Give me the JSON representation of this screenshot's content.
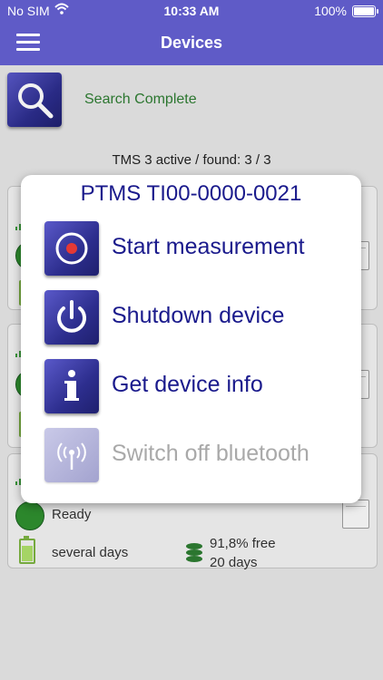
{
  "status_bar": {
    "carrier": "No SIM",
    "time": "10:33 AM",
    "battery_percent": "100%",
    "battery_level": 1.0
  },
  "nav": {
    "title": "Devices"
  },
  "search": {
    "status": "Search Complete",
    "summary": "TMS 3 active / found: 3 / 3"
  },
  "cards": [
    {
      "status": "",
      "battery": "",
      "storage_free": "",
      "storage_days": ""
    },
    {
      "status": "",
      "battery": "",
      "storage_free": "",
      "storage_days": ""
    },
    {
      "status": "Ready",
      "battery": "several days",
      "storage_free": "91,8% free",
      "storage_days": "20 days"
    }
  ],
  "modal": {
    "title": "PTMS TI00-0000-0021",
    "actions": [
      {
        "icon": "record-icon",
        "label": "Start measurement",
        "enabled": true
      },
      {
        "icon": "power-icon",
        "label": "Shutdown device",
        "enabled": true
      },
      {
        "icon": "info-icon",
        "label": "Get device info",
        "enabled": true
      },
      {
        "icon": "bluetooth-antenna-icon",
        "label": "Switch off bluetooth",
        "enabled": false
      }
    ]
  },
  "colors": {
    "header": "#5f5bc7",
    "button_dark": "#2d2e8e",
    "modal_text": "#1a1a8c",
    "status_green": "#2e7d32",
    "disabled_text": "#a9a9a9"
  }
}
